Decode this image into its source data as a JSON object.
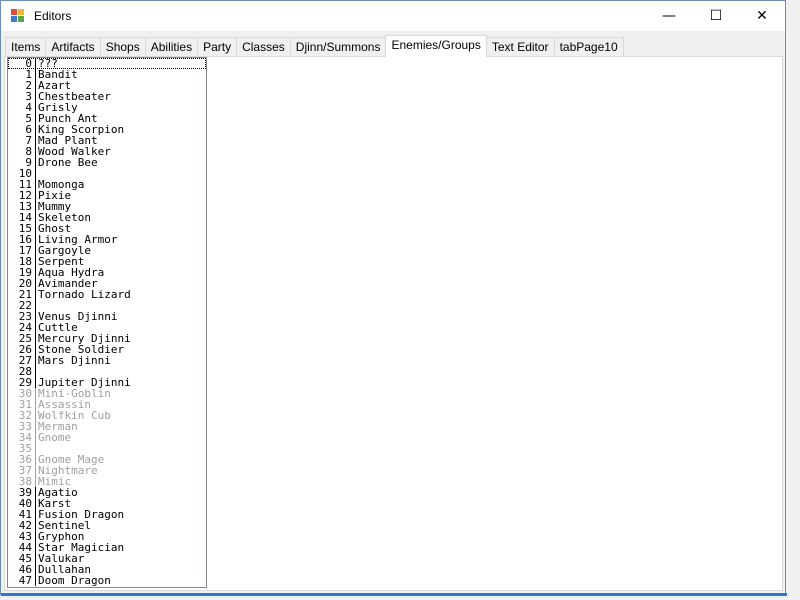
{
  "window": {
    "title": "Editors",
    "controls": {
      "minimize": "—",
      "maximize": "☐",
      "close": "✕"
    }
  },
  "tabs": [
    {
      "label": "Items"
    },
    {
      "label": "Artifacts"
    },
    {
      "label": "Shops"
    },
    {
      "label": "Abilities"
    },
    {
      "label": "Party"
    },
    {
      "label": "Classes"
    },
    {
      "label": "Djinn/Summons"
    },
    {
      "label": "Enemies/Groups",
      "active": true
    },
    {
      "label": "Text Editor"
    },
    {
      "label": "tabPage10"
    }
  ],
  "enemy_list": {
    "selected_index": 0,
    "items": [
      {
        "id": "0",
        "name": "???"
      },
      {
        "id": "1",
        "name": "Bandit"
      },
      {
        "id": "2",
        "name": "Azart"
      },
      {
        "id": "3",
        "name": "Chestbeater"
      },
      {
        "id": "4",
        "name": "Grisly"
      },
      {
        "id": "5",
        "name": "Punch Ant"
      },
      {
        "id": "6",
        "name": "King Scorpion"
      },
      {
        "id": "7",
        "name": "Mad Plant"
      },
      {
        "id": "8",
        "name": "Wood Walker"
      },
      {
        "id": "9",
        "name": "Drone Bee"
      },
      {
        "id": "10",
        "name": ""
      },
      {
        "id": "11",
        "name": "Momonga"
      },
      {
        "id": "12",
        "name": "Pixie"
      },
      {
        "id": "13",
        "name": "Mummy"
      },
      {
        "id": "14",
        "name": "Skeleton"
      },
      {
        "id": "15",
        "name": "Ghost"
      },
      {
        "id": "16",
        "name": "Living Armor"
      },
      {
        "id": "17",
        "name": "Gargoyle"
      },
      {
        "id": "18",
        "name": "Serpent"
      },
      {
        "id": "19",
        "name": "Aqua Hydra"
      },
      {
        "id": "20",
        "name": "Avimander"
      },
      {
        "id": "21",
        "name": "Tornado Lizard"
      },
      {
        "id": "22",
        "name": ""
      },
      {
        "id": "23",
        "name": "Venus Djinni"
      },
      {
        "id": "24",
        "name": "Cuttle"
      },
      {
        "id": "25",
        "name": "Mercury Djinni"
      },
      {
        "id": "26",
        "name": "Stone Soldier"
      },
      {
        "id": "27",
        "name": "Mars Djinni"
      },
      {
        "id": "28",
        "name": ""
      },
      {
        "id": "29",
        "name": "Jupiter Djinni"
      },
      {
        "id": "30",
        "name": "Mini-Goblin",
        "dim": true
      },
      {
        "id": "31",
        "name": "Assassin",
        "dim": true
      },
      {
        "id": "32",
        "name": "Wolfkin Cub",
        "dim": true
      },
      {
        "id": "33",
        "name": "Merman",
        "dim": true
      },
      {
        "id": "34",
        "name": "Gnome",
        "dim": true
      },
      {
        "id": "35",
        "name": "",
        "dim": true
      },
      {
        "id": "36",
        "name": "Gnome Mage",
        "dim": true
      },
      {
        "id": "37",
        "name": "Nightmare",
        "dim": true
      },
      {
        "id": "38",
        "name": "Mimic",
        "dim": true
      },
      {
        "id": "39",
        "name": "Agatio"
      },
      {
        "id": "40",
        "name": "Karst"
      },
      {
        "id": "41",
        "name": "Fusion Dragon"
      },
      {
        "id": "42",
        "name": "Sentinel"
      },
      {
        "id": "43",
        "name": "Gryphon"
      },
      {
        "id": "44",
        "name": "Star Magician"
      },
      {
        "id": "45",
        "name": "Valukar"
      },
      {
        "id": "46",
        "name": "Dullahan"
      },
      {
        "id": "47",
        "name": "Doom Dragon"
      }
    ]
  },
  "colors": {
    "accent": "#2b77d4",
    "icon_red": "#e04a3a",
    "icon_yellow": "#f2b530",
    "icon_blue": "#3a7bd5",
    "icon_green": "#57a64a"
  }
}
